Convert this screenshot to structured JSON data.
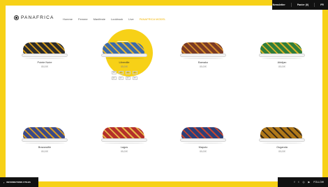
{
  "topbar": {
    "newsletter": "Newsletter",
    "cart": "Panier (0)",
    "lang": "FR"
  },
  "brand": {
    "name": "PANAFRICA"
  },
  "nav": [
    {
      "label": "Homme",
      "accent": false
    },
    {
      "label": "Femme",
      "accent": false
    },
    {
      "label": "Manifeste",
      "accent": false
    },
    {
      "label": "Lookbook",
      "accent": false
    },
    {
      "label": "Live",
      "accent": false
    },
    {
      "label": "PANAFRICA MODEL",
      "accent": true
    }
  ],
  "products": [
    {
      "name": "Pointe Noire",
      "price": "85,00€",
      "colors": [
        "#2b2b2b",
        "#d49a1a"
      ]
    },
    {
      "name": "Libreville",
      "price": "85,00€",
      "colors": [
        "#3a6aa8",
        "#e0b23a"
      ]
    },
    {
      "name": "Bamako",
      "price": "85,00€",
      "colors": [
        "#7a3a25",
        "#d48a2a"
      ]
    },
    {
      "name": "Abidjan",
      "price": "85,00€",
      "colors": [
        "#2f7d3a",
        "#d6b22a"
      ]
    },
    {
      "name": "Brazzaville",
      "price": "85,00€",
      "colors": [
        "#3b4a8a",
        "#d69a25"
      ]
    },
    {
      "name": "Lagos",
      "price": "85,00€",
      "colors": [
        "#b5302a",
        "#e7b84a"
      ]
    },
    {
      "name": "Maputo",
      "price": "85,00€",
      "colors": [
        "#2d3f78",
        "#c8452d"
      ]
    },
    {
      "name": "Ouganda",
      "price": "85,00€",
      "colors": [
        "#b07818",
        "#3a2a18"
      ]
    }
  ],
  "sizes": [
    "38",
    "39",
    "40",
    "41",
    "42",
    "43",
    "44",
    "45"
  ],
  "bottombar": {
    "label": "INFORMATIONS UTILES"
  },
  "social": {
    "icons": [
      "facebook-icon",
      "twitter-icon",
      "instagram-icon",
      "youtube-icon"
    ],
    "label": "FOLLOW"
  }
}
